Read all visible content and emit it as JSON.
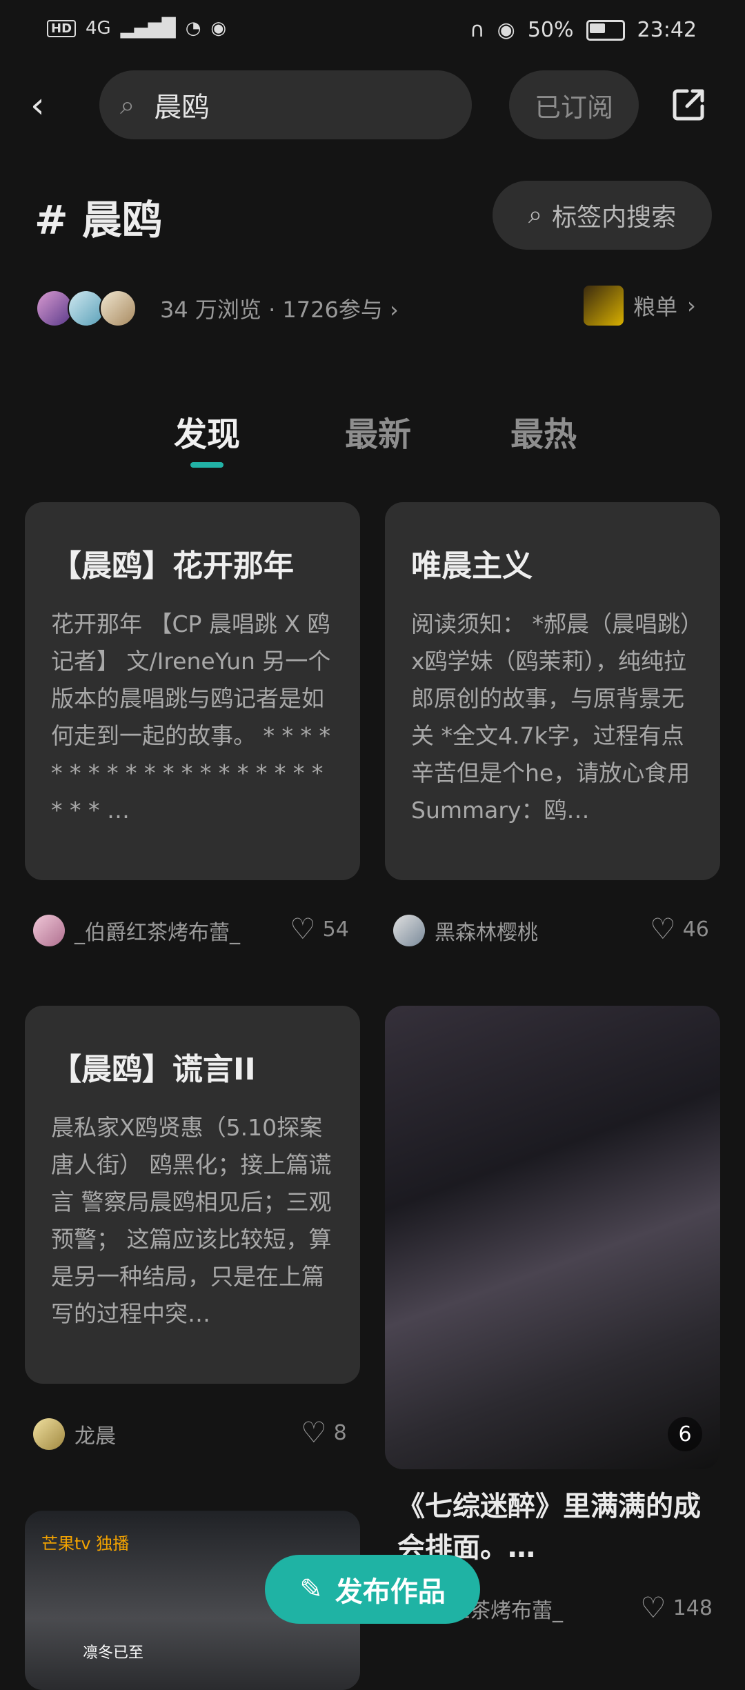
{
  "status_bar": {
    "hd": "HD",
    "network": "4G",
    "battery_percent": "50%",
    "time": "23:42"
  },
  "nav": {
    "search_query": "晨鸥",
    "subscribed_label": "已订阅"
  },
  "tag": {
    "title": "# 晨鸥",
    "tag_search_label": "标签内搜索",
    "stats": "34 万浏览 · 1726参与",
    "liang_label": "粮单"
  },
  "tabs": [
    "发现",
    "最新",
    "最热"
  ],
  "cards": [
    {
      "title": "【晨鸥】花开那年",
      "body": "花开那年 【CP 晨唱跳 X 鸥记者】 文/IreneYun 另一个版本的晨唱跳与鸥记者是如何走到一起的故事。 * * * * * * * * * * * * * * * * * * * * * * …",
      "author": "_伯爵红茶烤布蕾_",
      "likes": "54"
    },
    {
      "title": "唯晨主义",
      "body": "阅读须知： *郝晨（晨唱跳）x鸥学妹（鸥茉莉），纯纯拉郎原创的故事，与原背景无关 *全文4.7k字，过程有点辛苦但是个he，请放心食用 Summary：鸥…",
      "author": "黑森林樱桃",
      "likes": "46"
    },
    {
      "title": "【晨鸥】谎言II",
      "body": "晨私家X鸥贤惠（5.10探案唐人街） 鸥黑化；接上篇谎言 警察局晨鸥相见后；三观预警； 这篇应该比较短，算是另一种结局，只是在上篇写的过程中突…",
      "author": "龙晨",
      "likes": "8"
    }
  ],
  "photo_card": {
    "image_count": "6",
    "title": "《七综迷醉》里满满的成会排面。…",
    "author": "_伯爵红茶烤布蕾_",
    "likes": "148"
  },
  "bottom_card": {
    "logo": "芒果tv 独播",
    "caption": "凛冬已至"
  },
  "publish_label": "发布作品",
  "colors": {
    "accent": "#1fb3a4",
    "background": "#141414",
    "card": "#2f2f2f"
  }
}
